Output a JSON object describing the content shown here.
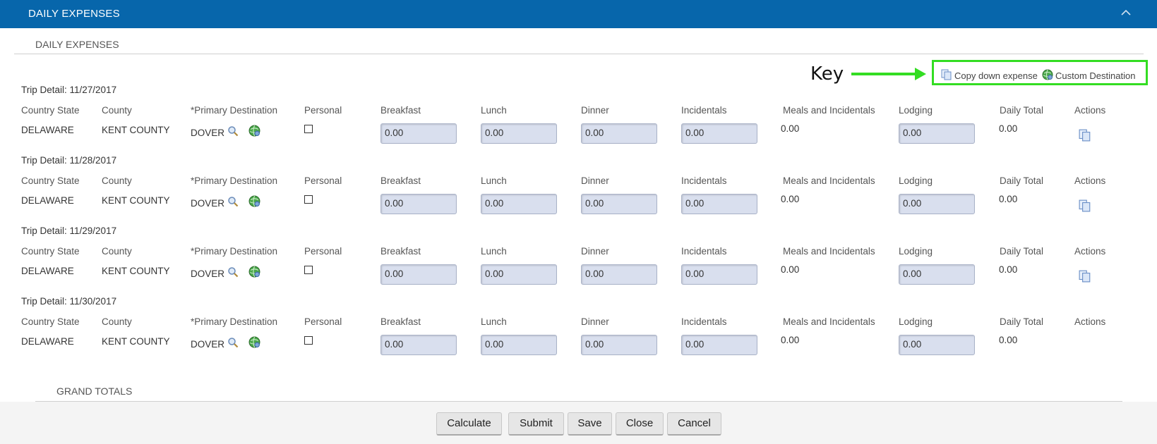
{
  "header": {
    "title": "DAILY EXPENSES"
  },
  "section": {
    "title": "DAILY EXPENSES"
  },
  "key": {
    "label": "Key",
    "copy_label": "Copy down expense",
    "custom_label": "Custom Destination",
    "highlight_color": "#33dd22"
  },
  "columns": [
    "Country State",
    "County",
    "*Primary Destination",
    "Personal",
    "Breakfast",
    "Lunch",
    "Dinner",
    "Incidentals",
    "Meals and Incidentals",
    "Lodging",
    "Daily Total",
    "Actions"
  ],
  "trips": [
    {
      "title": "Trip Detail: 11/27/2017",
      "state": "DELAWARE",
      "county": "KENT COUNTY",
      "destination": "DOVER",
      "breakfast": "0.00",
      "lunch": "0.00",
      "dinner": "0.00",
      "incidentals": "0.00",
      "mi": "0.00",
      "lodging": "0.00",
      "daily_total": "0.00",
      "has_action": true
    },
    {
      "title": "Trip Detail: 11/28/2017",
      "state": "DELAWARE",
      "county": "KENT COUNTY",
      "destination": "DOVER",
      "breakfast": "0.00",
      "lunch": "0.00",
      "dinner": "0.00",
      "incidentals": "0.00",
      "mi": "0.00",
      "lodging": "0.00",
      "daily_total": "0.00",
      "has_action": true
    },
    {
      "title": "Trip Detail: 11/29/2017",
      "state": "DELAWARE",
      "county": "KENT COUNTY",
      "destination": "DOVER",
      "breakfast": "0.00",
      "lunch": "0.00",
      "dinner": "0.00",
      "incidentals": "0.00",
      "mi": "0.00",
      "lodging": "0.00",
      "daily_total": "0.00",
      "has_action": true
    },
    {
      "title": "Trip Detail: 11/30/2017",
      "state": "DELAWARE",
      "county": "KENT COUNTY",
      "destination": "DOVER",
      "breakfast": "0.00",
      "lunch": "0.00",
      "dinner": "0.00",
      "incidentals": "0.00",
      "mi": "0.00",
      "lodging": "0.00",
      "daily_total": "0.00",
      "has_action": false
    }
  ],
  "grand_totals": {
    "title": "GRAND TOTALS"
  },
  "footer": {
    "calculate": "Calculate",
    "submit": "Submit",
    "save": "Save",
    "close": "Close",
    "cancel": "Cancel"
  },
  "colors": {
    "header_bg": "#0766ab",
    "input_bg": "#d9dfee",
    "footer_bg": "#f4f4f4"
  },
  "icons": [
    "chevron-up-icon",
    "copy-icon",
    "globe-icon",
    "magnifier-icon",
    "arrow-right-icon"
  ]
}
